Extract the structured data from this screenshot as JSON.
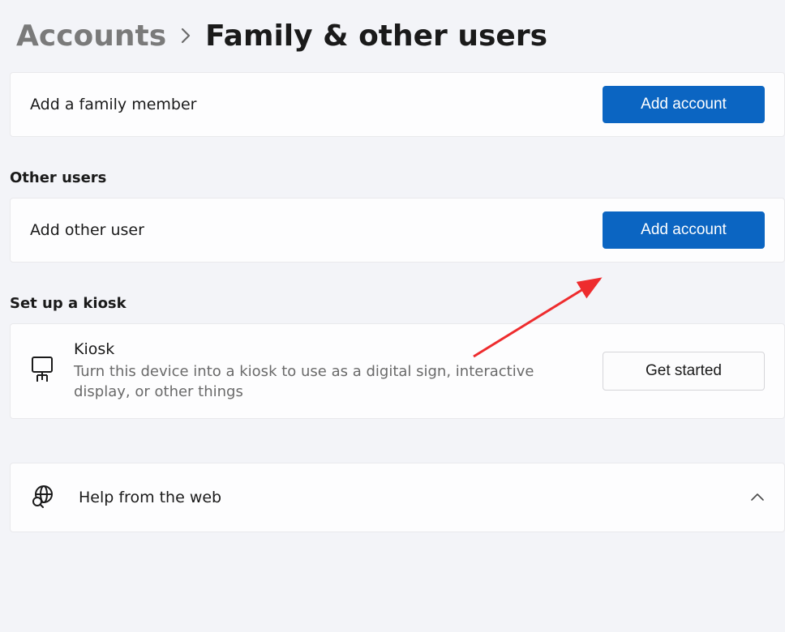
{
  "breadcrumb": {
    "parent": "Accounts",
    "current": "Family & other users"
  },
  "family": {
    "add_member_label": "Add a family member",
    "add_button": "Add account"
  },
  "other_users": {
    "section_title": "Other users",
    "add_other_label": "Add other user",
    "add_button": "Add account"
  },
  "kiosk": {
    "section_title": "Set up a kiosk",
    "title": "Kiosk",
    "description": "Turn this device into a kiosk to use as a digital sign, interactive display, or other things",
    "button": "Get started"
  },
  "help": {
    "label": "Help from the web"
  },
  "colors": {
    "accent": "#0b65c2",
    "arrow": "#ee2c2e"
  }
}
